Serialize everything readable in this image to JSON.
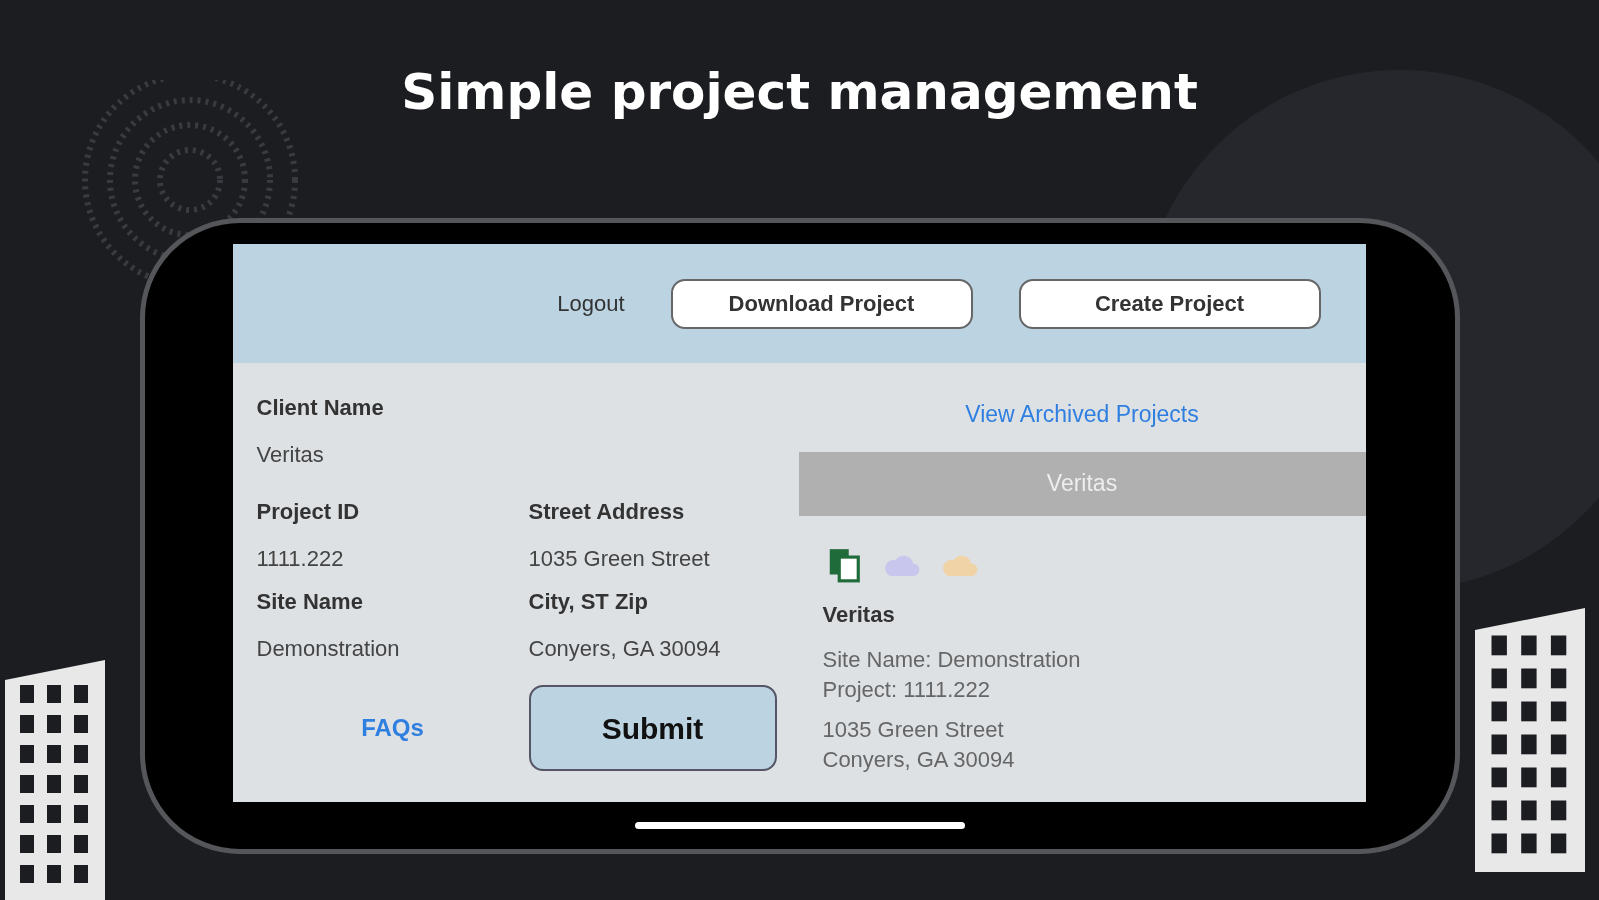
{
  "headline": "Simple project management",
  "header": {
    "logout": "Logout",
    "buttons": [
      "Download Project",
      "Create Project"
    ]
  },
  "form": {
    "client": {
      "label": "Client Name",
      "value": "Veritas"
    },
    "fields": [
      {
        "label": "Project ID",
        "value": "1111.222"
      },
      {
        "label": "Street Address",
        "value": "1035 Green Street"
      },
      {
        "label": "Site Name",
        "value": "Demonstration"
      },
      {
        "label": "City, ST Zip",
        "value": "Conyers, GA 30094"
      }
    ],
    "faqs": "FAQs",
    "submit": "Submit"
  },
  "projects": {
    "archived_link": "View Archived Projects",
    "selected_header": "Veritas",
    "card": {
      "title": "Veritas",
      "lines": [
        "Site Name: Demonstration",
        "Project: 1111.222"
      ],
      "address": [
        "1035 Green Street",
        "Conyers, GA 30094"
      ]
    }
  }
}
